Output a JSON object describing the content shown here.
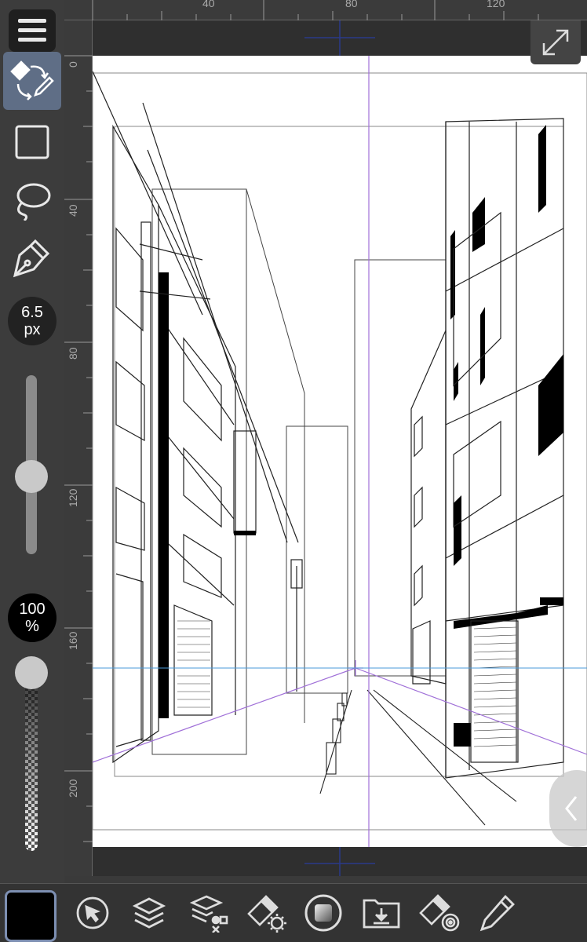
{
  "left_toolbar": {
    "menu_icon": "hamburger-icon",
    "tools": [
      {
        "name": "pen-eraser-switch-icon",
        "active": true
      },
      {
        "name": "rectangle-selection-icon",
        "active": false
      },
      {
        "name": "lasso-icon",
        "active": false
      },
      {
        "name": "pen-nib-icon",
        "active": false
      }
    ],
    "brush_size": {
      "value": "6.5",
      "unit": "px"
    },
    "opacity": {
      "value": "100",
      "unit": "%"
    }
  },
  "rulers": {
    "top_labels": [
      "40",
      "80",
      "120"
    ],
    "left_labels": [
      "0",
      "40",
      "80",
      "120",
      "160",
      "200"
    ]
  },
  "canvas": {
    "expand_icon": "expand-diagonal-icon",
    "edge_handle_icon": "chevron-left-icon"
  },
  "bottom_toolbar": {
    "color": "#000000",
    "buttons": [
      "pointer-circle-icon",
      "layers-icon",
      "layer-properties-icon",
      "eraser-settings-icon",
      "record-icon",
      "download-folder-icon",
      "eraser-target-icon",
      "pencil-icon"
    ]
  },
  "colors": {
    "accent": "#5f6e86",
    "guide_purple": "#a070d8",
    "horizon_blue": "#4a9ad8",
    "toolbar": "#3c3c3c"
  }
}
